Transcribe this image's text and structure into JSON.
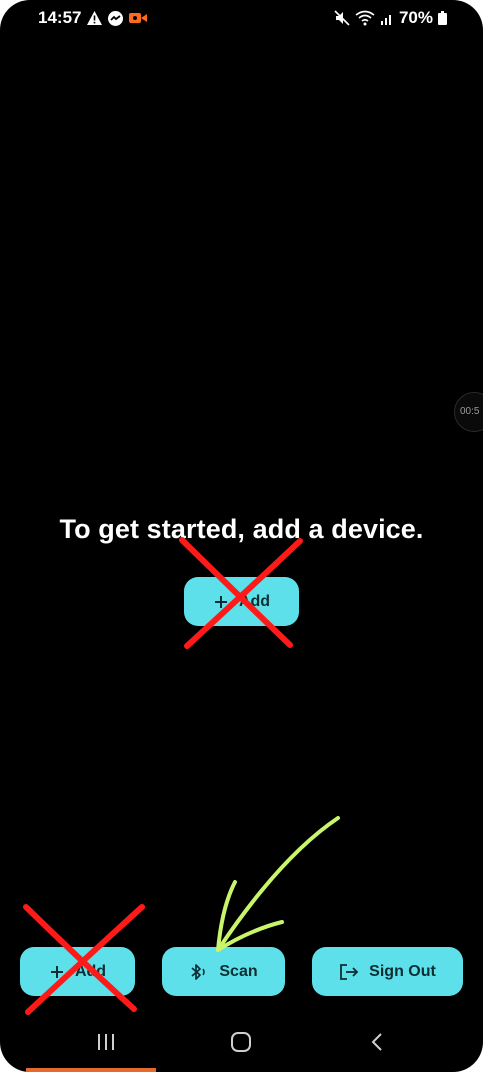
{
  "status_bar": {
    "time": "14:57",
    "battery": "70%"
  },
  "timer": {
    "text": "00:5"
  },
  "main": {
    "empty_message": "To get started, add a device.",
    "add_label": "Add"
  },
  "bottom_bar": {
    "add_label": "Add",
    "scan_label": "Scan",
    "sign_out_label": "Sign Out"
  },
  "colors": {
    "background": "#000000",
    "button": "#5ee0ea",
    "button_text": "#0b2e33",
    "annotation_x": "#ff1a1a",
    "annotation_arrow": "#c9f56a"
  },
  "icons": {
    "status_left": [
      "warning-icon",
      "messenger-icon",
      "video-record-icon"
    ],
    "status_right": [
      "mute-icon",
      "wifi-icon",
      "signal-icon",
      "battery-icon"
    ],
    "nav": [
      "recent-apps-icon",
      "home-icon",
      "back-icon"
    ]
  }
}
